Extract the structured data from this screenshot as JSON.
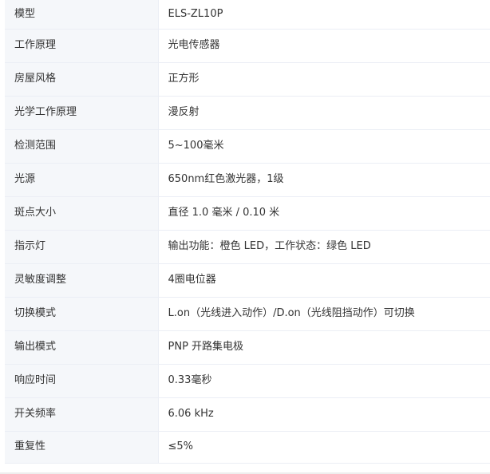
{
  "specs": [
    {
      "label": "模型",
      "value": "ELS-ZL10P"
    },
    {
      "label": "工作原理",
      "value": "光电传感器"
    },
    {
      "label": "房屋风格",
      "value": "正方形"
    },
    {
      "label": "光学工作原理",
      "value": "漫反射"
    },
    {
      "label": "检测范围",
      "value": "5~100毫米"
    },
    {
      "label": "光源",
      "value": "650nm红色激光器，1级"
    },
    {
      "label": "斑点大小",
      "value": "直径 1.0 毫米 / 0.10 米"
    },
    {
      "label": "指示灯",
      "value": "输出功能：橙色 LED，工作状态：绿色 LED"
    },
    {
      "label": "灵敏度调整",
      "value": "4圈电位器"
    },
    {
      "label": "切换模式",
      "value": "L.on（光线进入动作）/D.on（光线阻挡动作）可切换"
    },
    {
      "label": "输出模式",
      "value": "PNP 开路集电极"
    },
    {
      "label": "响应时间",
      "value": "0.33毫秒"
    },
    {
      "label": "开关频率",
      "value": "6.06 kHz"
    },
    {
      "label": "重复性",
      "value": "≤5%"
    }
  ]
}
